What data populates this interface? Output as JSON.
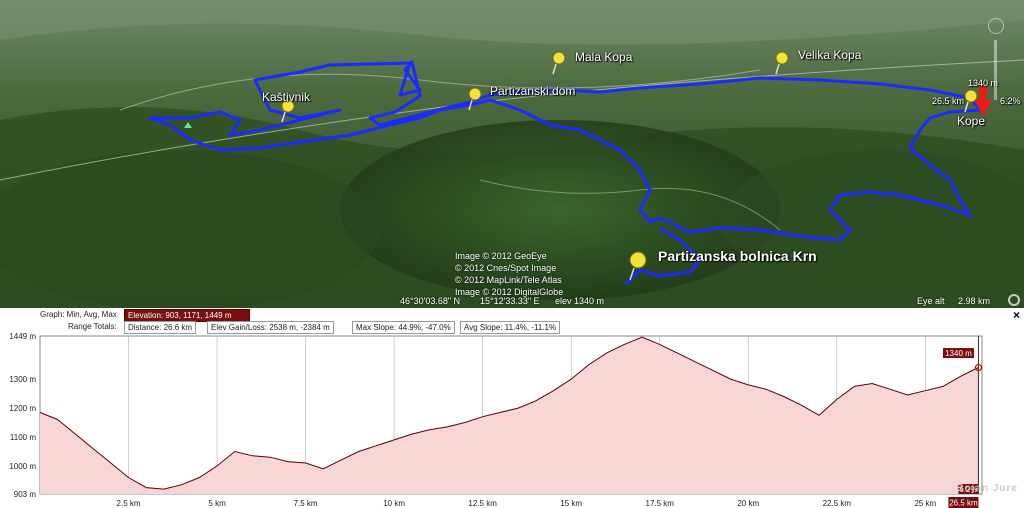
{
  "map": {
    "labels": {
      "kastivnik": "Kaštivnik",
      "mala_kopa": "Mala Kopa",
      "partizanski_dom": "Partizanski dom",
      "velika_kopa": "Velika Kopa",
      "kope": "Kope",
      "bolnica": "Partizanska bolnica Krn"
    },
    "credits": [
      "Image © 2012 GeoEye",
      "© 2012 Cnes/Spot Image",
      "© 2012 MapLink/Tele Atlas",
      "Image © 2012 DigitalGlobe"
    ],
    "status": {
      "lat": "46°30'03.68\" N",
      "lon": "15°12'33.33\" E",
      "elev": "elev  1340 m",
      "eye_label": "Eye alt",
      "eye_value": "2.98 km"
    },
    "cursor": {
      "elevation": "1340 m",
      "distance": "26.5 km",
      "slope": "6.2%"
    }
  },
  "profile": {
    "graph_label": "Graph: Min, Avg, Max",
    "elevation_stats": "Elevation: 903, 1171, 1449 m",
    "range_totals_label": "Range Totals:",
    "distance": "Distance: 26.6 km",
    "gain_loss": "Elev Gain/Loss: 2538 m, -2384 m",
    "max_slope": "Max Slope: 44.9%, -47.0%",
    "avg_slope": "Avg Slope: 11.4%, -11.1%",
    "close_label": "×",
    "watermark": "Bojan Jure"
  },
  "chart_data": {
    "type": "area",
    "xlabel": "",
    "ylabel": "",
    "x_ticks": [
      "2.5 km",
      "5 km",
      "7.5 km",
      "10 km",
      "12.5 km",
      "15 km",
      "17.5 km",
      "20 km",
      "22.5 km",
      "25 km"
    ],
    "x_tick_values": [
      2.5,
      5,
      7.5,
      10,
      12.5,
      15,
      17.5,
      20,
      22.5,
      25
    ],
    "y_ticks": [
      "1449 m",
      "1300 m",
      "1200 m",
      "1100 m",
      "1000 m",
      "903 m"
    ],
    "y_tick_values": [
      1449,
      1300,
      1200,
      1100,
      1000,
      903
    ],
    "xlim": [
      0,
      26.6
    ],
    "ylim": [
      903,
      1449
    ],
    "x": [
      0,
      0.5,
      1,
      1.5,
      2,
      2.5,
      3,
      3.5,
      4,
      4.5,
      5,
      5.5,
      6,
      6.5,
      7,
      7.5,
      8,
      8.5,
      9,
      9.5,
      10,
      10.5,
      11,
      11.5,
      12,
      12.5,
      13,
      13.5,
      14,
      14.5,
      15,
      15.5,
      16,
      16.5,
      17,
      17.5,
      18,
      18.5,
      19,
      19.5,
      20,
      20.5,
      21,
      21.5,
      22,
      22.5,
      23,
      23.5,
      24,
      24.5,
      25,
      25.5,
      26,
      26.5
    ],
    "y": [
      1185,
      1160,
      1110,
      1060,
      1010,
      960,
      925,
      920,
      935,
      960,
      1000,
      1050,
      1035,
      1030,
      1015,
      1010,
      990,
      1020,
      1050,
      1070,
      1090,
      1110,
      1125,
      1135,
      1150,
      1170,
      1185,
      1200,
      1225,
      1260,
      1300,
      1350,
      1390,
      1420,
      1445,
      1420,
      1390,
      1360,
      1330,
      1300,
      1280,
      1265,
      1240,
      1210,
      1175,
      1230,
      1275,
      1285,
      1265,
      1245,
      1260,
      1275,
      1310,
      1340
    ],
    "cursor_x": 26.5,
    "cursor_label": "1340 m",
    "cursor_slope_label": "6.2%",
    "cursor_distance_label": "26.5 km",
    "fill_color": "#f8d6d6",
    "line_color": "#5a0000"
  },
  "colors": {
    "track": "#1b2bff",
    "pin": "#f2e23a",
    "hot": "#7a0d0d"
  }
}
